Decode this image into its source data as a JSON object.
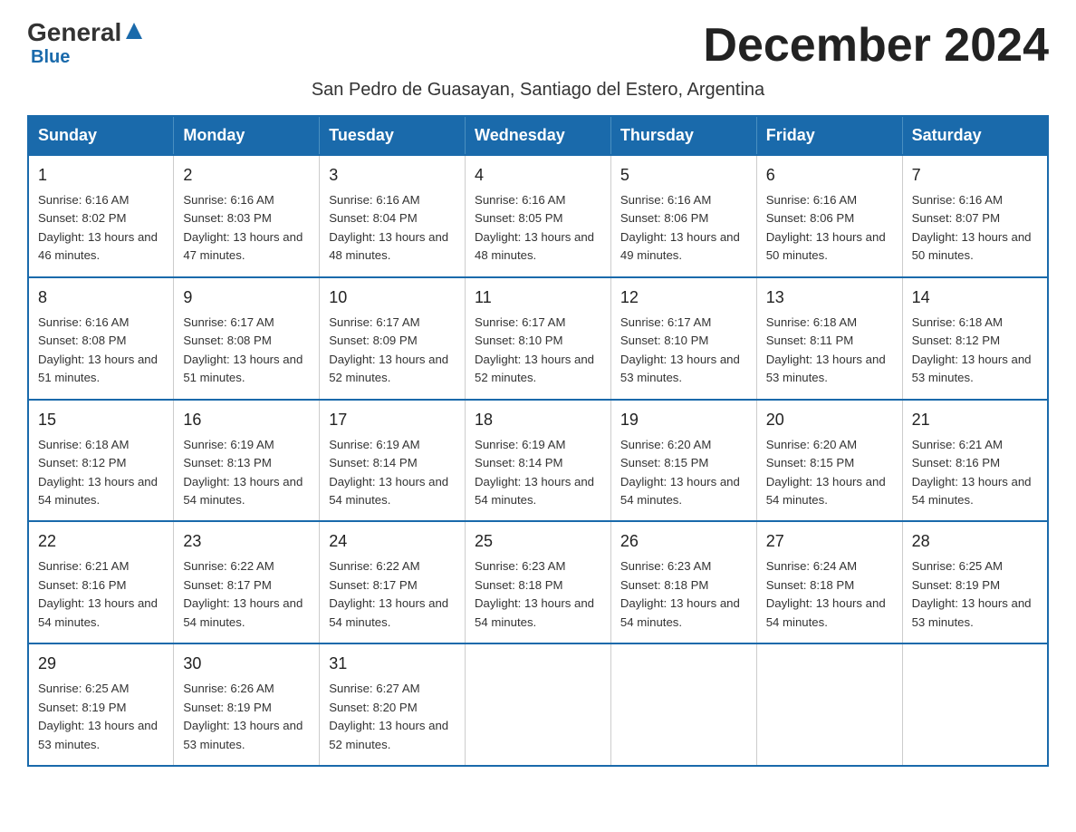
{
  "logo": {
    "general": "General",
    "blue": "Blue",
    "subtitle": "Blue"
  },
  "title": "December 2024",
  "location": "San Pedro de Guasayan, Santiago del Estero, Argentina",
  "weekdays": [
    "Sunday",
    "Monday",
    "Tuesday",
    "Wednesday",
    "Thursday",
    "Friday",
    "Saturday"
  ],
  "weeks": [
    [
      {
        "day": "1",
        "sunrise": "6:16 AM",
        "sunset": "8:02 PM",
        "daylight": "13 hours and 46 minutes."
      },
      {
        "day": "2",
        "sunrise": "6:16 AM",
        "sunset": "8:03 PM",
        "daylight": "13 hours and 47 minutes."
      },
      {
        "day": "3",
        "sunrise": "6:16 AM",
        "sunset": "8:04 PM",
        "daylight": "13 hours and 48 minutes."
      },
      {
        "day": "4",
        "sunrise": "6:16 AM",
        "sunset": "8:05 PM",
        "daylight": "13 hours and 48 minutes."
      },
      {
        "day": "5",
        "sunrise": "6:16 AM",
        "sunset": "8:06 PM",
        "daylight": "13 hours and 49 minutes."
      },
      {
        "day": "6",
        "sunrise": "6:16 AM",
        "sunset": "8:06 PM",
        "daylight": "13 hours and 50 minutes."
      },
      {
        "day": "7",
        "sunrise": "6:16 AM",
        "sunset": "8:07 PM",
        "daylight": "13 hours and 50 minutes."
      }
    ],
    [
      {
        "day": "8",
        "sunrise": "6:16 AM",
        "sunset": "8:08 PM",
        "daylight": "13 hours and 51 minutes."
      },
      {
        "day": "9",
        "sunrise": "6:17 AM",
        "sunset": "8:08 PM",
        "daylight": "13 hours and 51 minutes."
      },
      {
        "day": "10",
        "sunrise": "6:17 AM",
        "sunset": "8:09 PM",
        "daylight": "13 hours and 52 minutes."
      },
      {
        "day": "11",
        "sunrise": "6:17 AM",
        "sunset": "8:10 PM",
        "daylight": "13 hours and 52 minutes."
      },
      {
        "day": "12",
        "sunrise": "6:17 AM",
        "sunset": "8:10 PM",
        "daylight": "13 hours and 53 minutes."
      },
      {
        "day": "13",
        "sunrise": "6:18 AM",
        "sunset": "8:11 PM",
        "daylight": "13 hours and 53 minutes."
      },
      {
        "day": "14",
        "sunrise": "6:18 AM",
        "sunset": "8:12 PM",
        "daylight": "13 hours and 53 minutes."
      }
    ],
    [
      {
        "day": "15",
        "sunrise": "6:18 AM",
        "sunset": "8:12 PM",
        "daylight": "13 hours and 54 minutes."
      },
      {
        "day": "16",
        "sunrise": "6:19 AM",
        "sunset": "8:13 PM",
        "daylight": "13 hours and 54 minutes."
      },
      {
        "day": "17",
        "sunrise": "6:19 AM",
        "sunset": "8:14 PM",
        "daylight": "13 hours and 54 minutes."
      },
      {
        "day": "18",
        "sunrise": "6:19 AM",
        "sunset": "8:14 PM",
        "daylight": "13 hours and 54 minutes."
      },
      {
        "day": "19",
        "sunrise": "6:20 AM",
        "sunset": "8:15 PM",
        "daylight": "13 hours and 54 minutes."
      },
      {
        "day": "20",
        "sunrise": "6:20 AM",
        "sunset": "8:15 PM",
        "daylight": "13 hours and 54 minutes."
      },
      {
        "day": "21",
        "sunrise": "6:21 AM",
        "sunset": "8:16 PM",
        "daylight": "13 hours and 54 minutes."
      }
    ],
    [
      {
        "day": "22",
        "sunrise": "6:21 AM",
        "sunset": "8:16 PM",
        "daylight": "13 hours and 54 minutes."
      },
      {
        "day": "23",
        "sunrise": "6:22 AM",
        "sunset": "8:17 PM",
        "daylight": "13 hours and 54 minutes."
      },
      {
        "day": "24",
        "sunrise": "6:22 AM",
        "sunset": "8:17 PM",
        "daylight": "13 hours and 54 minutes."
      },
      {
        "day": "25",
        "sunrise": "6:23 AM",
        "sunset": "8:18 PM",
        "daylight": "13 hours and 54 minutes."
      },
      {
        "day": "26",
        "sunrise": "6:23 AM",
        "sunset": "8:18 PM",
        "daylight": "13 hours and 54 minutes."
      },
      {
        "day": "27",
        "sunrise": "6:24 AM",
        "sunset": "8:18 PM",
        "daylight": "13 hours and 54 minutes."
      },
      {
        "day": "28",
        "sunrise": "6:25 AM",
        "sunset": "8:19 PM",
        "daylight": "13 hours and 53 minutes."
      }
    ],
    [
      {
        "day": "29",
        "sunrise": "6:25 AM",
        "sunset": "8:19 PM",
        "daylight": "13 hours and 53 minutes."
      },
      {
        "day": "30",
        "sunrise": "6:26 AM",
        "sunset": "8:19 PM",
        "daylight": "13 hours and 53 minutes."
      },
      {
        "day": "31",
        "sunrise": "6:27 AM",
        "sunset": "8:20 PM",
        "daylight": "13 hours and 52 minutes."
      },
      null,
      null,
      null,
      null
    ]
  ]
}
